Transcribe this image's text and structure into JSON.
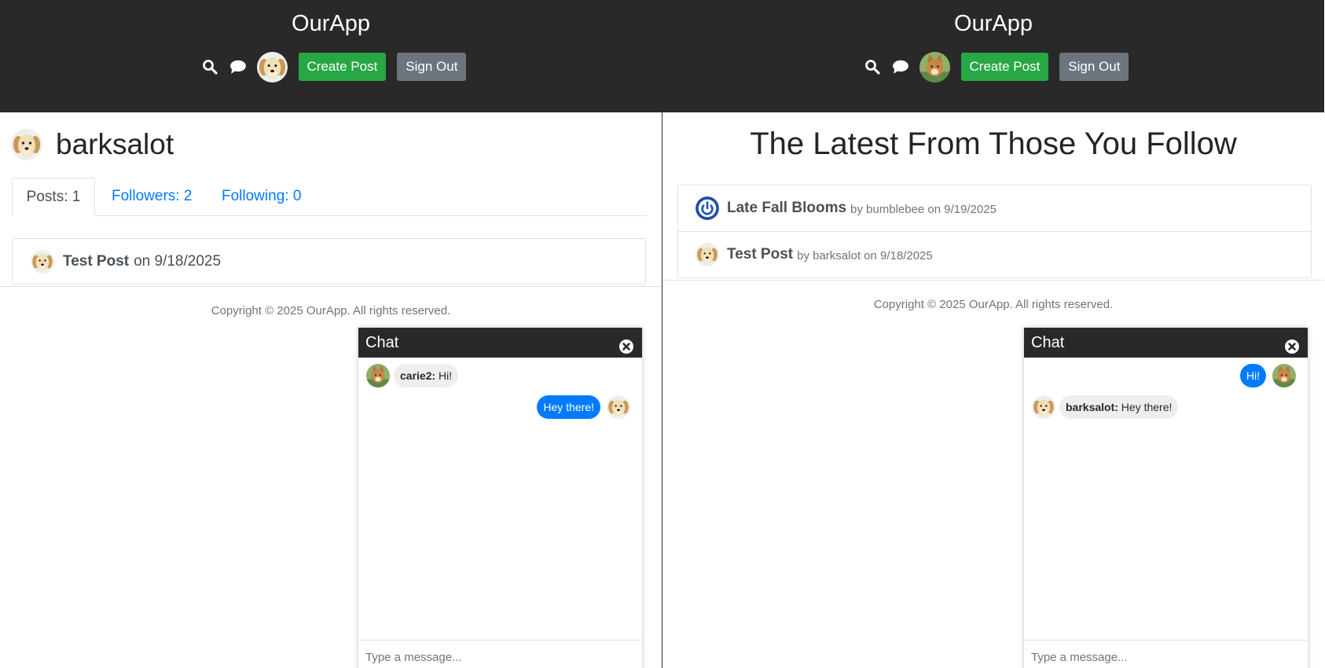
{
  "app": {
    "title": "OurApp",
    "create_post_label": "Create Post",
    "sign_out_label": "Sign Out"
  },
  "colors": {
    "header_bg": "#292929",
    "success": "#28a745",
    "secondary": "#6c757d",
    "link": "#007bff",
    "bubble_mine": "#007bff",
    "bubble_theirs": "#eeeeee"
  },
  "left": {
    "profile": {
      "username": "barksalot",
      "tabs": [
        {
          "label": "Posts: 1",
          "active": true
        },
        {
          "label": "Followers: 2",
          "active": false
        },
        {
          "label": "Following: 0",
          "active": false
        }
      ],
      "posts": [
        {
          "title": "Test Post",
          "meta": "on 9/18/2025"
        }
      ]
    },
    "footer": "Copyright © 2025 OurApp. All rights reserved.",
    "chat": {
      "title": "Chat",
      "messages": [
        {
          "from": "carie2:",
          "text": " Hi!",
          "mine": false
        },
        {
          "text": "Hey there!",
          "mine": true
        }
      ],
      "input_placeholder": "Type a message..."
    }
  },
  "right": {
    "feed": {
      "heading": "The Latest From Those You Follow",
      "items": [
        {
          "title": "Late Fall Blooms",
          "meta": "by bumblebee on 9/19/2025"
        },
        {
          "title": "Test Post",
          "meta": "by barksalot on 9/18/2025"
        }
      ]
    },
    "footer": "Copyright © 2025 OurApp. All rights reserved.",
    "chat": {
      "title": "Chat",
      "messages": [
        {
          "text": "Hi!",
          "mine": true
        },
        {
          "from": "barksalot:",
          "text": " Hey there!",
          "mine": false
        }
      ],
      "input_placeholder": "Type a message..."
    }
  }
}
